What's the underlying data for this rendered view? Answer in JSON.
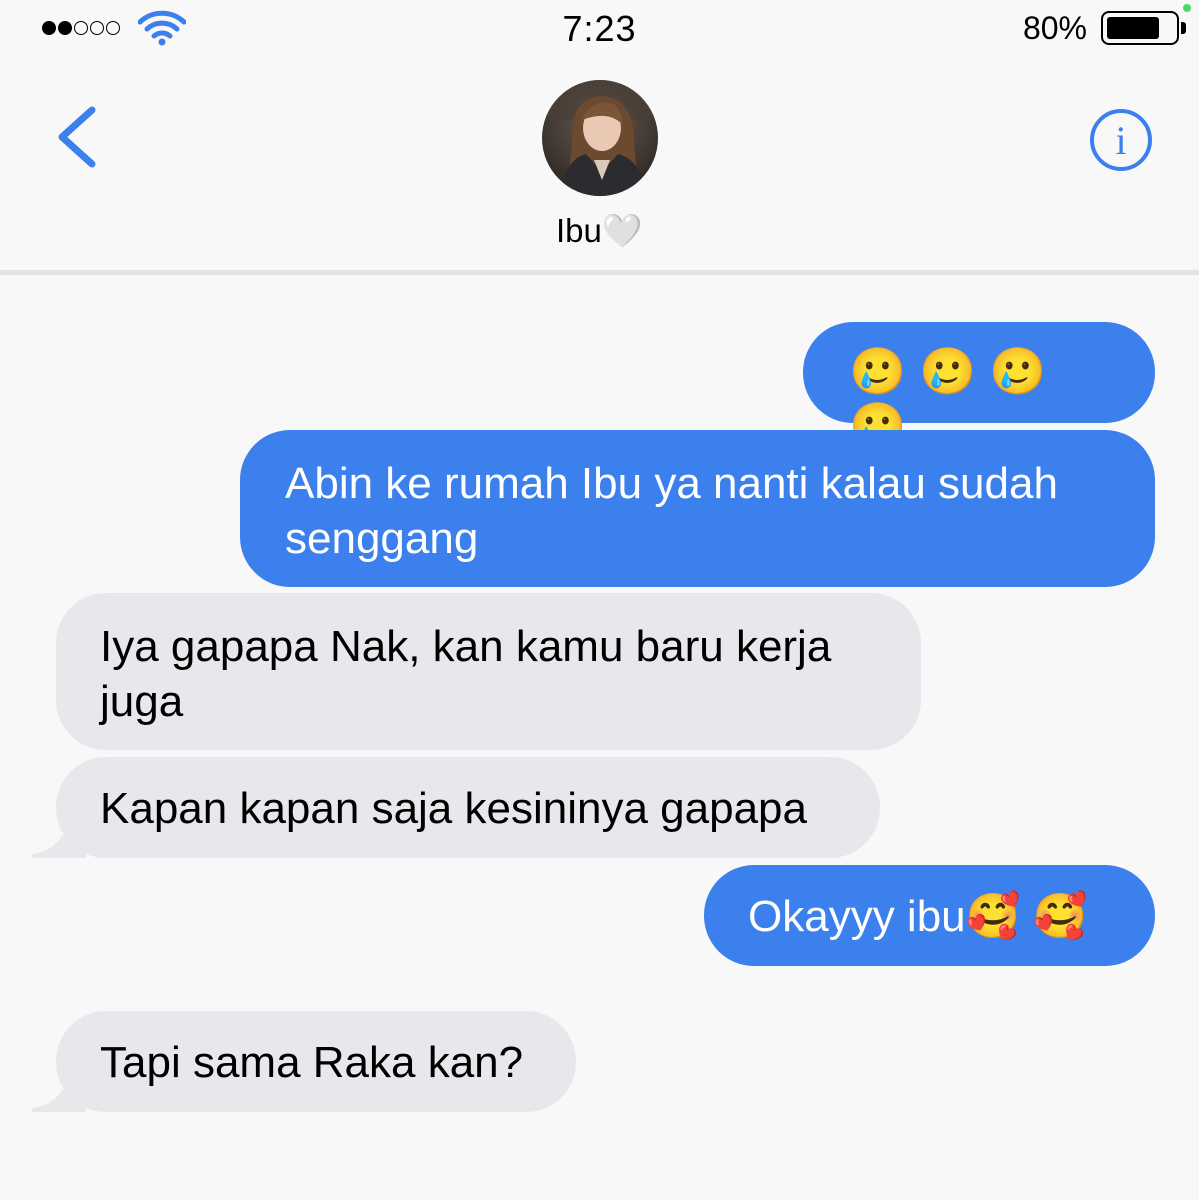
{
  "status_bar": {
    "time": "7:23",
    "battery_percent": "80%",
    "battery_level": 0.8,
    "signal_bars": 2,
    "signal_total": 5
  },
  "header": {
    "contact_name": "Ibu🤍",
    "back_icon": "chevron-left-icon",
    "info_icon": "info-circle-icon"
  },
  "colors": {
    "accent": "#3b80ec",
    "received_bubble": "#e8e8ec",
    "background": "#f8f8f8"
  },
  "messages": [
    {
      "direction": "sent",
      "text": "🥲 🥲 🥲 🥲"
    },
    {
      "direction": "sent",
      "text": "Abin ke rumah Ibu ya nanti kalau sudah\nsenggang"
    },
    {
      "direction": "received",
      "text": "Iya gapapa Nak, kan kamu baru kerja\njuga"
    },
    {
      "direction": "received",
      "text": "Kapan kapan saja kesininya gapapa"
    },
    {
      "direction": "sent",
      "text": "Okayyy ibu🥰 🥰"
    },
    {
      "direction": "received",
      "text": "Tapi sama Raka kan?"
    }
  ]
}
